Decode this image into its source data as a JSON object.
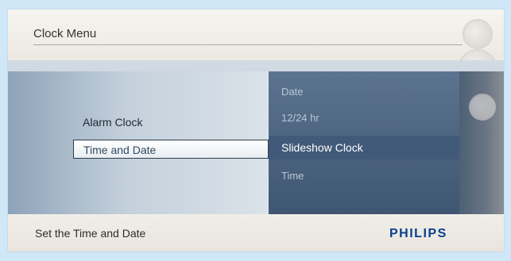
{
  "header": {
    "title": "Clock Menu"
  },
  "menu": {
    "items": [
      {
        "label": "Alarm Clock",
        "selected": false
      },
      {
        "label": "Time and Date",
        "selected": true
      }
    ]
  },
  "submenu": {
    "items": [
      {
        "label": "Date",
        "selected": false
      },
      {
        "label": "12/24 hr",
        "selected": false
      },
      {
        "label": "Slideshow Clock",
        "selected": true
      },
      {
        "label": "Time",
        "selected": false
      }
    ]
  },
  "footer": {
    "hint": "Set the Time and Date",
    "brand": "PHILIPS"
  },
  "colors": {
    "page_background": "#cfe7f7",
    "brand_blue": "#0a3f8f",
    "panel_dark": "#3f5672",
    "highlight_dark": "#415a79"
  },
  "icons": [
    "decorative-ring-icon",
    "decorative-ring-icon",
    "decorative-ring-icon"
  ]
}
